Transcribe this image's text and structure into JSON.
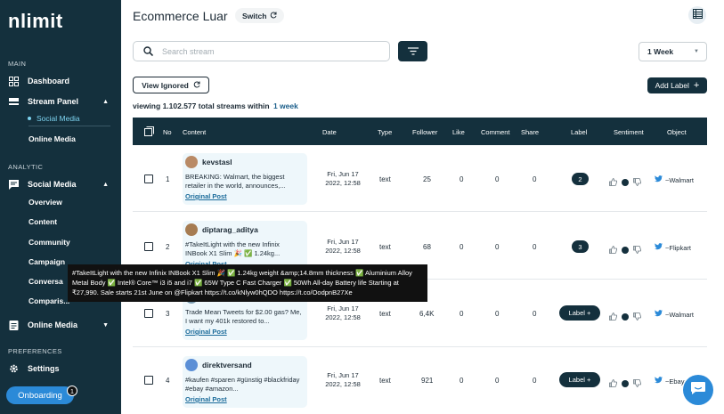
{
  "sidebar": {
    "logo": "nlimit",
    "sections": {
      "main": "MAIN",
      "analytic": "ANALYTIC",
      "preferences": "PREFERENCES"
    },
    "dashboard": "Dashboard",
    "stream_panel": "Stream Panel",
    "social_media_sub": "Social Media",
    "online_media_sub": "Online Media",
    "social_media": "Social Media",
    "analytic_items": [
      "Overview",
      "Content",
      "Community",
      "Campaign",
      "Conversa",
      "Comparis..."
    ],
    "online_media": "Online Media",
    "settings": "Settings",
    "onboarding": "Onboarding",
    "onboarding_badge": "1"
  },
  "header": {
    "title": "Ecommerce Luar",
    "switch_label": "Switch"
  },
  "toolbar": {
    "search_placeholder": "Search stream",
    "period": "1 Week",
    "view_ignored": "View Ignored",
    "add_label": "Add Label"
  },
  "summary": {
    "prefix": "viewing",
    "count": "1.102.577",
    "middle": "total streams within",
    "period": "1 week"
  },
  "table": {
    "headers": [
      "No",
      "Content",
      "Date",
      "Type",
      "Follower",
      "Like",
      "Comment",
      "Share",
      "Label",
      "Sentiment",
      "Object"
    ],
    "rows": [
      {
        "no": "1",
        "user": "kevstasl",
        "snippet": "BREAKING: Walmart, the biggest retailer in the world, announces,...",
        "orig": "Original Post",
        "date_line1": "Fri, Jun 17",
        "date_line2": "2022, 12:58",
        "type": "text",
        "follower": "25",
        "like": "0",
        "comment": "0",
        "share": "0",
        "label": "2",
        "object": "~Walmart"
      },
      {
        "no": "2",
        "user": "diptarag_aditya",
        "snippet": "#TakeItLight with the new Infinix INBook X1 Slim 🎉 ✅ 1.24kg...",
        "orig": "Original Post",
        "date_line1": "Fri, Jun 17",
        "date_line2": "2022, 12:58",
        "type": "text",
        "follower": "68",
        "like": "0",
        "comment": "0",
        "share": "0",
        "label": "3",
        "object": "~Flipkart"
      },
      {
        "no": "3",
        "user": "",
        "snippet": "Trade Mean Tweets for $2.00 gas? Me, I want my 401k restored to...",
        "orig": "Original Post",
        "date_line1": "Fri, Jun 17",
        "date_line2": "2022, 12:58",
        "type": "text",
        "follower": "6,4K",
        "like": "0",
        "comment": "0",
        "share": "0",
        "label": "Label +",
        "object": "~Walmart"
      },
      {
        "no": "4",
        "user": "direktversand",
        "snippet": "#kaufen #sparen #günstig #blackfriday #ebay #amazon...",
        "orig": "Original Post",
        "date_line1": "Fri, Jun 17",
        "date_line2": "2022, 12:58",
        "type": "text",
        "follower": "921",
        "like": "0",
        "comment": "0",
        "share": "0",
        "label": "Label +",
        "object": "~Ebay"
      }
    ]
  },
  "tooltip": {
    "text": "#TakeItLight with the new Infinix INBook X1 Slim 🎉 ✅ 1.24kg weight &amp;14.8mm thickness ✅ Aluminium Alloy Metal Body ✅ Intel® Core™ i3 i5 and i7 ✅ 65W Type C Fast Charger ✅ 50Wh All-day Battery life Starting at ₹27,990. Sale starts 21st June on @Flipkart https://t.co/kNlyw0hQDO https://t.co/OodpnB27Xe"
  },
  "colors": {
    "sidebar_bg": "#14303d",
    "accent_blue": "#2b8ad8",
    "link_blue": "#1b6b9a",
    "card_bg": "#eef7fb"
  }
}
